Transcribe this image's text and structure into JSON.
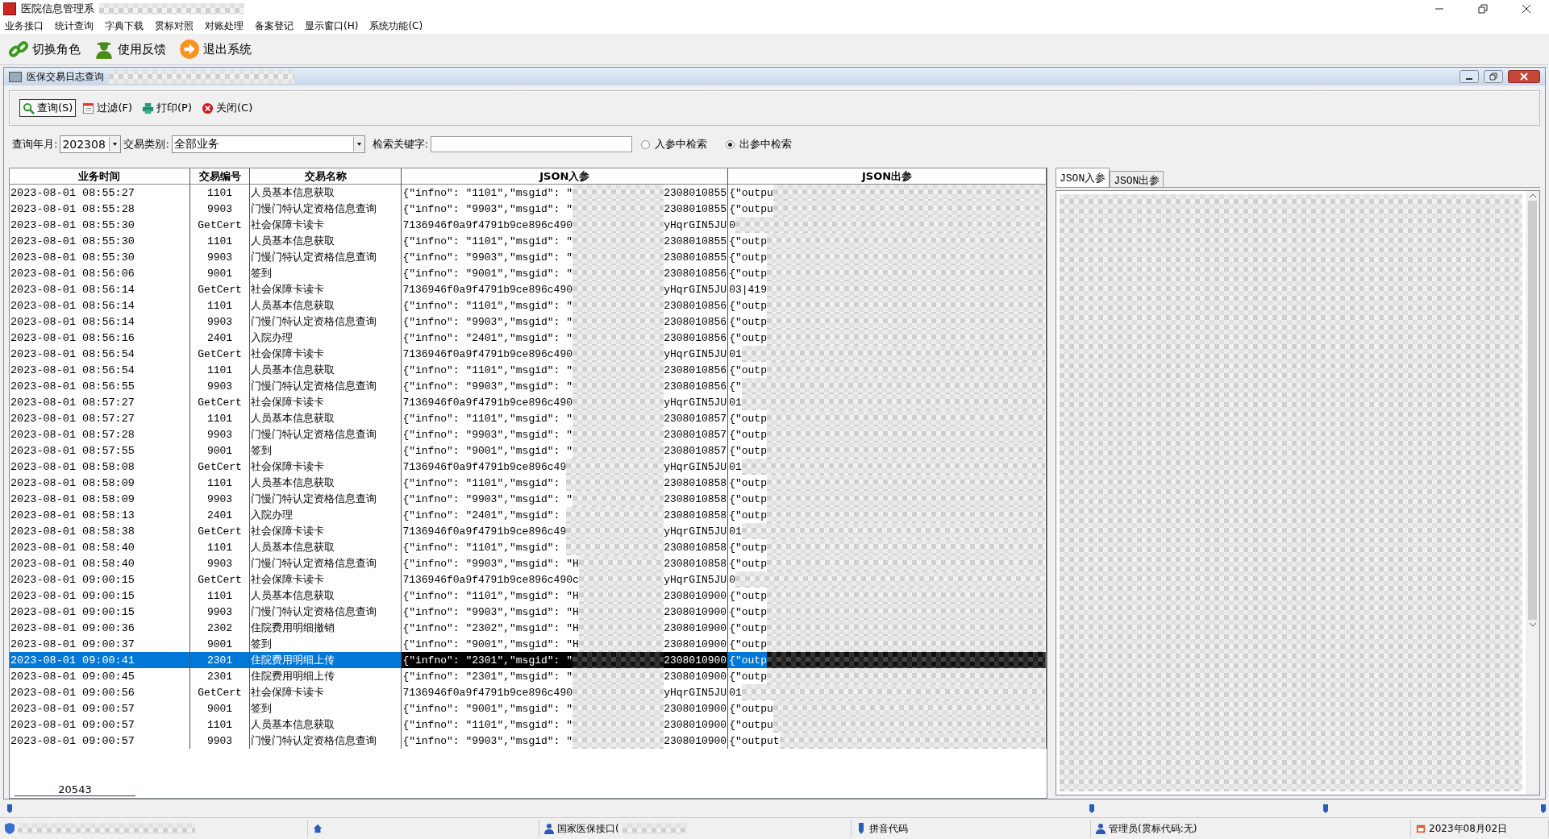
{
  "window": {
    "title": "医院信息管理系"
  },
  "menu": [
    "业务接口",
    "统计查询",
    "字典下载",
    "贯标对照",
    "对账处理",
    "备案登记",
    "显示窗口(H)",
    "系统功能(C)"
  ],
  "toolbar": [
    {
      "kind": "link",
      "label": "切换角色"
    },
    {
      "kind": "person",
      "label": "使用反馈"
    },
    {
      "kind": "exit",
      "label": "退出系统"
    }
  ],
  "child": {
    "title": "医保交易日志查询",
    "buttons": [
      {
        "kind": "search",
        "label": "查询(S)",
        "selected": true
      },
      {
        "kind": "filter",
        "label": "过滤(F)",
        "selected": false
      },
      {
        "kind": "print",
        "label": "打印(P)",
        "selected": false
      },
      {
        "kind": "close",
        "label": "关闭(C)",
        "selected": false
      }
    ],
    "filters": {
      "month_label": "查询年月:",
      "month": "202308",
      "type_label": "交易类别:",
      "type": "全部业务",
      "keyword_label": "检索关键字:",
      "options": [
        {
          "label": "入参中检索",
          "selected": false
        },
        {
          "label": "出参中检索",
          "selected": true
        }
      ]
    },
    "table": {
      "columns": [
        "业务时间",
        "交易编号",
        "交易名称",
        "JSON入参",
        "JSON出参"
      ],
      "rows": [
        {
          "time": "2023-08-01 08:55:27",
          "code": "1101",
          "name": "人员基本信息获取",
          "in_head": "{\"infno\": \"1101\",\"msgid\": \"",
          "in_tail": "2308010855",
          "out_head": "{\"outpu",
          "selected": false
        },
        {
          "time": "2023-08-01 08:55:28",
          "code": "9903",
          "name": "门慢门特认定资格信息查询",
          "in_head": "{\"infno\": \"9903\",\"msgid\": \"",
          "in_tail": "2308010855",
          "out_head": "{\"outpu",
          "selected": false
        },
        {
          "time": "2023-08-01 08:55:30",
          "code": "GetCert",
          "name": "社会保障卡读卡",
          "in_head": "7136946f0a9f4791b9ce896c490",
          "in_tail": "yHqrGIN5JU",
          "out_head": "0",
          "selected": false
        },
        {
          "time": "2023-08-01 08:55:30",
          "code": "1101",
          "name": "人员基本信息获取",
          "in_head": "{\"infno\": \"1101\",\"msgid\": \"",
          "in_tail": "2308010855",
          "out_head": "{\"outp",
          "selected": false
        },
        {
          "time": "2023-08-01 08:55:30",
          "code": "9903",
          "name": "门慢门特认定资格信息查询",
          "in_head": "{\"infno\": \"9903\",\"msgid\": \"",
          "in_tail": "2308010855",
          "out_head": "{\"outp",
          "selected": false
        },
        {
          "time": "2023-08-01 08:56:06",
          "code": "9001",
          "name": "签到",
          "in_head": "{\"infno\": \"9001\",\"msgid\": \"",
          "in_tail": "2308010856",
          "out_head": "{\"outp",
          "selected": false
        },
        {
          "time": "2023-08-01 08:56:14",
          "code": "GetCert",
          "name": "社会保障卡读卡",
          "in_head": "7136946f0a9f4791b9ce896c490",
          "in_tail": "yHqrGIN5JU",
          "out_head": "03|419",
          "selected": false
        },
        {
          "time": "2023-08-01 08:56:14",
          "code": "1101",
          "name": "人员基本信息获取",
          "in_head": "{\"infno\": \"1101\",\"msgid\": \"",
          "in_tail": "2308010856",
          "out_head": "{\"outp",
          "selected": false
        },
        {
          "time": "2023-08-01 08:56:14",
          "code": "9903",
          "name": "门慢门特认定资格信息查询",
          "in_head": "{\"infno\": \"9903\",\"msgid\": \"",
          "in_tail": "2308010856",
          "out_head": "{\"outp",
          "selected": false
        },
        {
          "time": "2023-08-01 08:56:16",
          "code": "2401",
          "name": "入院办理",
          "in_head": "{\"infno\": \"2401\",\"msgid\": \"",
          "in_tail": "2308010856",
          "out_head": "{\"outp",
          "selected": false
        },
        {
          "time": "2023-08-01 08:56:54",
          "code": "GetCert",
          "name": "社会保障卡读卡",
          "in_head": "7136946f0a9f4791b9ce896c490",
          "in_tail": "yHqrGIN5JU",
          "out_head": "01",
          "selected": false
        },
        {
          "time": "2023-08-01 08:56:54",
          "code": "1101",
          "name": "人员基本信息获取",
          "in_head": "{\"infno\": \"1101\",\"msgid\": \"",
          "in_tail": "2308010856",
          "out_head": "{\"outp",
          "selected": false
        },
        {
          "time": "2023-08-01 08:56:55",
          "code": "9903",
          "name": "门慢门特认定资格信息查询",
          "in_head": "{\"infno\": \"9903\",\"msgid\": \"",
          "in_tail": "2308010856",
          "out_head": "{\"",
          "selected": false
        },
        {
          "time": "2023-08-01 08:57:27",
          "code": "GetCert",
          "name": "社会保障卡读卡",
          "in_head": "7136946f0a9f4791b9ce896c490",
          "in_tail": "yHqrGIN5JU",
          "out_head": "01",
          "selected": false
        },
        {
          "time": "2023-08-01 08:57:27",
          "code": "1101",
          "name": "人员基本信息获取",
          "in_head": "{\"infno\": \"1101\",\"msgid\": \"",
          "in_tail": "2308010857",
          "out_head": "{\"outp",
          "selected": false
        },
        {
          "time": "2023-08-01 08:57:28",
          "code": "9903",
          "name": "门慢门特认定资格信息查询",
          "in_head": "{\"infno\": \"9903\",\"msgid\": \"",
          "in_tail": "2308010857",
          "out_head": "{\"outp",
          "selected": false
        },
        {
          "time": "2023-08-01 08:57:55",
          "code": "9001",
          "name": "签到",
          "in_head": "{\"infno\": \"9001\",\"msgid\": \"",
          "in_tail": "2308010857",
          "out_head": "{\"outp",
          "selected": false
        },
        {
          "time": "2023-08-01 08:58:08",
          "code": "GetCert",
          "name": "社会保障卡读卡",
          "in_head": "7136946f0a9f4791b9ce896c49",
          "in_tail": "yHqrGIN5JU",
          "out_head": "01",
          "selected": false
        },
        {
          "time": "2023-08-01 08:58:09",
          "code": "1101",
          "name": "人员基本信息获取",
          "in_head": "{\"infno\": \"1101\",\"msgid\": ",
          "in_tail": "2308010858",
          "out_head": "{\"outp",
          "selected": false
        },
        {
          "time": "2023-08-01 08:58:09",
          "code": "9903",
          "name": "门慢门特认定资格信息查询",
          "in_head": "{\"infno\": \"9903\",\"msgid\": \"",
          "in_tail": "2308010858",
          "out_head": "{\"outp",
          "selected": false
        },
        {
          "time": "2023-08-01 08:58:13",
          "code": "2401",
          "name": "入院办理",
          "in_head": "{\"infno\": \"2401\",\"msgid\": ",
          "in_tail": "2308010858",
          "out_head": "{\"outp",
          "selected": false
        },
        {
          "time": "2023-08-01 08:58:38",
          "code": "GetCert",
          "name": "社会保障卡读卡",
          "in_head": "7136946f0a9f4791b9ce896c49",
          "in_tail": "yHqrGIN5JU",
          "out_head": "01",
          "selected": false
        },
        {
          "time": "2023-08-01 08:58:40",
          "code": "1101",
          "name": "人员基本信息获取",
          "in_head": "{\"infno\": \"1101\",\"msgid\": ",
          "in_tail": "2308010858",
          "out_head": "{\"outp",
          "selected": false
        },
        {
          "time": "2023-08-01 08:58:40",
          "code": "9903",
          "name": "门慢门特认定资格信息查询",
          "in_head": "{\"infno\": \"9903\",\"msgid\": \"H",
          "in_tail": "2308010858",
          "out_head": "{\"outp",
          "selected": false
        },
        {
          "time": "2023-08-01 09:00:15",
          "code": "GetCert",
          "name": "社会保障卡读卡",
          "in_head": "7136946f0a9f4791b9ce896c490c",
          "in_tail": "yHqrGIN5JU",
          "out_head": "0",
          "selected": false
        },
        {
          "time": "2023-08-01 09:00:15",
          "code": "1101",
          "name": "人员基本信息获取",
          "in_head": "{\"infno\": \"1101\",\"msgid\": \"H",
          "in_tail": "2308010900",
          "out_head": "{\"outp",
          "selected": false
        },
        {
          "time": "2023-08-01 09:00:15",
          "code": "9903",
          "name": "门慢门特认定资格信息查询",
          "in_head": "{\"infno\": \"9903\",\"msgid\": \"H",
          "in_tail": "2308010900",
          "out_head": "{\"outp",
          "selected": false
        },
        {
          "time": "2023-08-01 09:00:36",
          "code": "2302",
          "name": "住院费用明细撤销",
          "in_head": "{\"infno\": \"2302\",\"msgid\": \"H",
          "in_tail": "2308010900",
          "out_head": "{\"outp",
          "selected": false
        },
        {
          "time": "2023-08-01 09:00:37",
          "code": "9001",
          "name": "签到",
          "in_head": "{\"infno\": \"9001\",\"msgid\": \"H",
          "in_tail": "2308010900",
          "out_head": "{\"outp",
          "selected": false
        },
        {
          "time": "2023-08-01 09:00:41",
          "code": "2301",
          "name": "住院费用明细上传",
          "in_head": "{\"infno\": \"2301\",\"msgid\": \"",
          "in_tail": "2308010900",
          "out_head": "{\"outp",
          "selected": true
        },
        {
          "time": "2023-08-01 09:00:45",
          "code": "2301",
          "name": "住院费用明细上传",
          "in_head": "{\"infno\": \"2301\",\"msgid\": \"",
          "in_tail": "2308010900",
          "out_head": "{\"outp",
          "selected": false
        },
        {
          "time": "2023-08-01 09:00:56",
          "code": "GetCert",
          "name": "社会保障卡读卡",
          "in_head": "7136946f0a9f4791b9ce896c490",
          "in_tail": "yHqrGIN5JU",
          "out_head": "01",
          "selected": false
        },
        {
          "time": "2023-08-01 09:00:57",
          "code": "9001",
          "name": "签到",
          "in_head": "{\"infno\": \"9001\",\"msgid\": \"",
          "in_tail": "2308010900",
          "out_head": "{\"outpu",
          "selected": false
        },
        {
          "time": "2023-08-01 09:00:57",
          "code": "1101",
          "name": "人员基本信息获取",
          "in_head": "{\"infno\": \"1101\",\"msgid\": \"",
          "in_tail": "2308010900",
          "out_head": "{\"outpu",
          "selected": false
        },
        {
          "time": "2023-08-01 09:00:57",
          "code": "9903",
          "name": "门慢门特认定资格信息查询",
          "in_head": "{\"infno\": \"9903\",\"msgid\": \"",
          "in_tail": "2308010900",
          "out_head": "{\"output",
          "selected": false
        }
      ],
      "count": "20543"
    },
    "detail": {
      "tabs": [
        {
          "label": "JSON入参",
          "selected": true
        },
        {
          "label": "JSON出参",
          "selected": false
        }
      ]
    }
  },
  "status_bar": {
    "interface": "国家医保接口(",
    "pinyin": "拼音代码",
    "user": "管理员(贯标代码:无)",
    "date": "2023年08月02日"
  }
}
